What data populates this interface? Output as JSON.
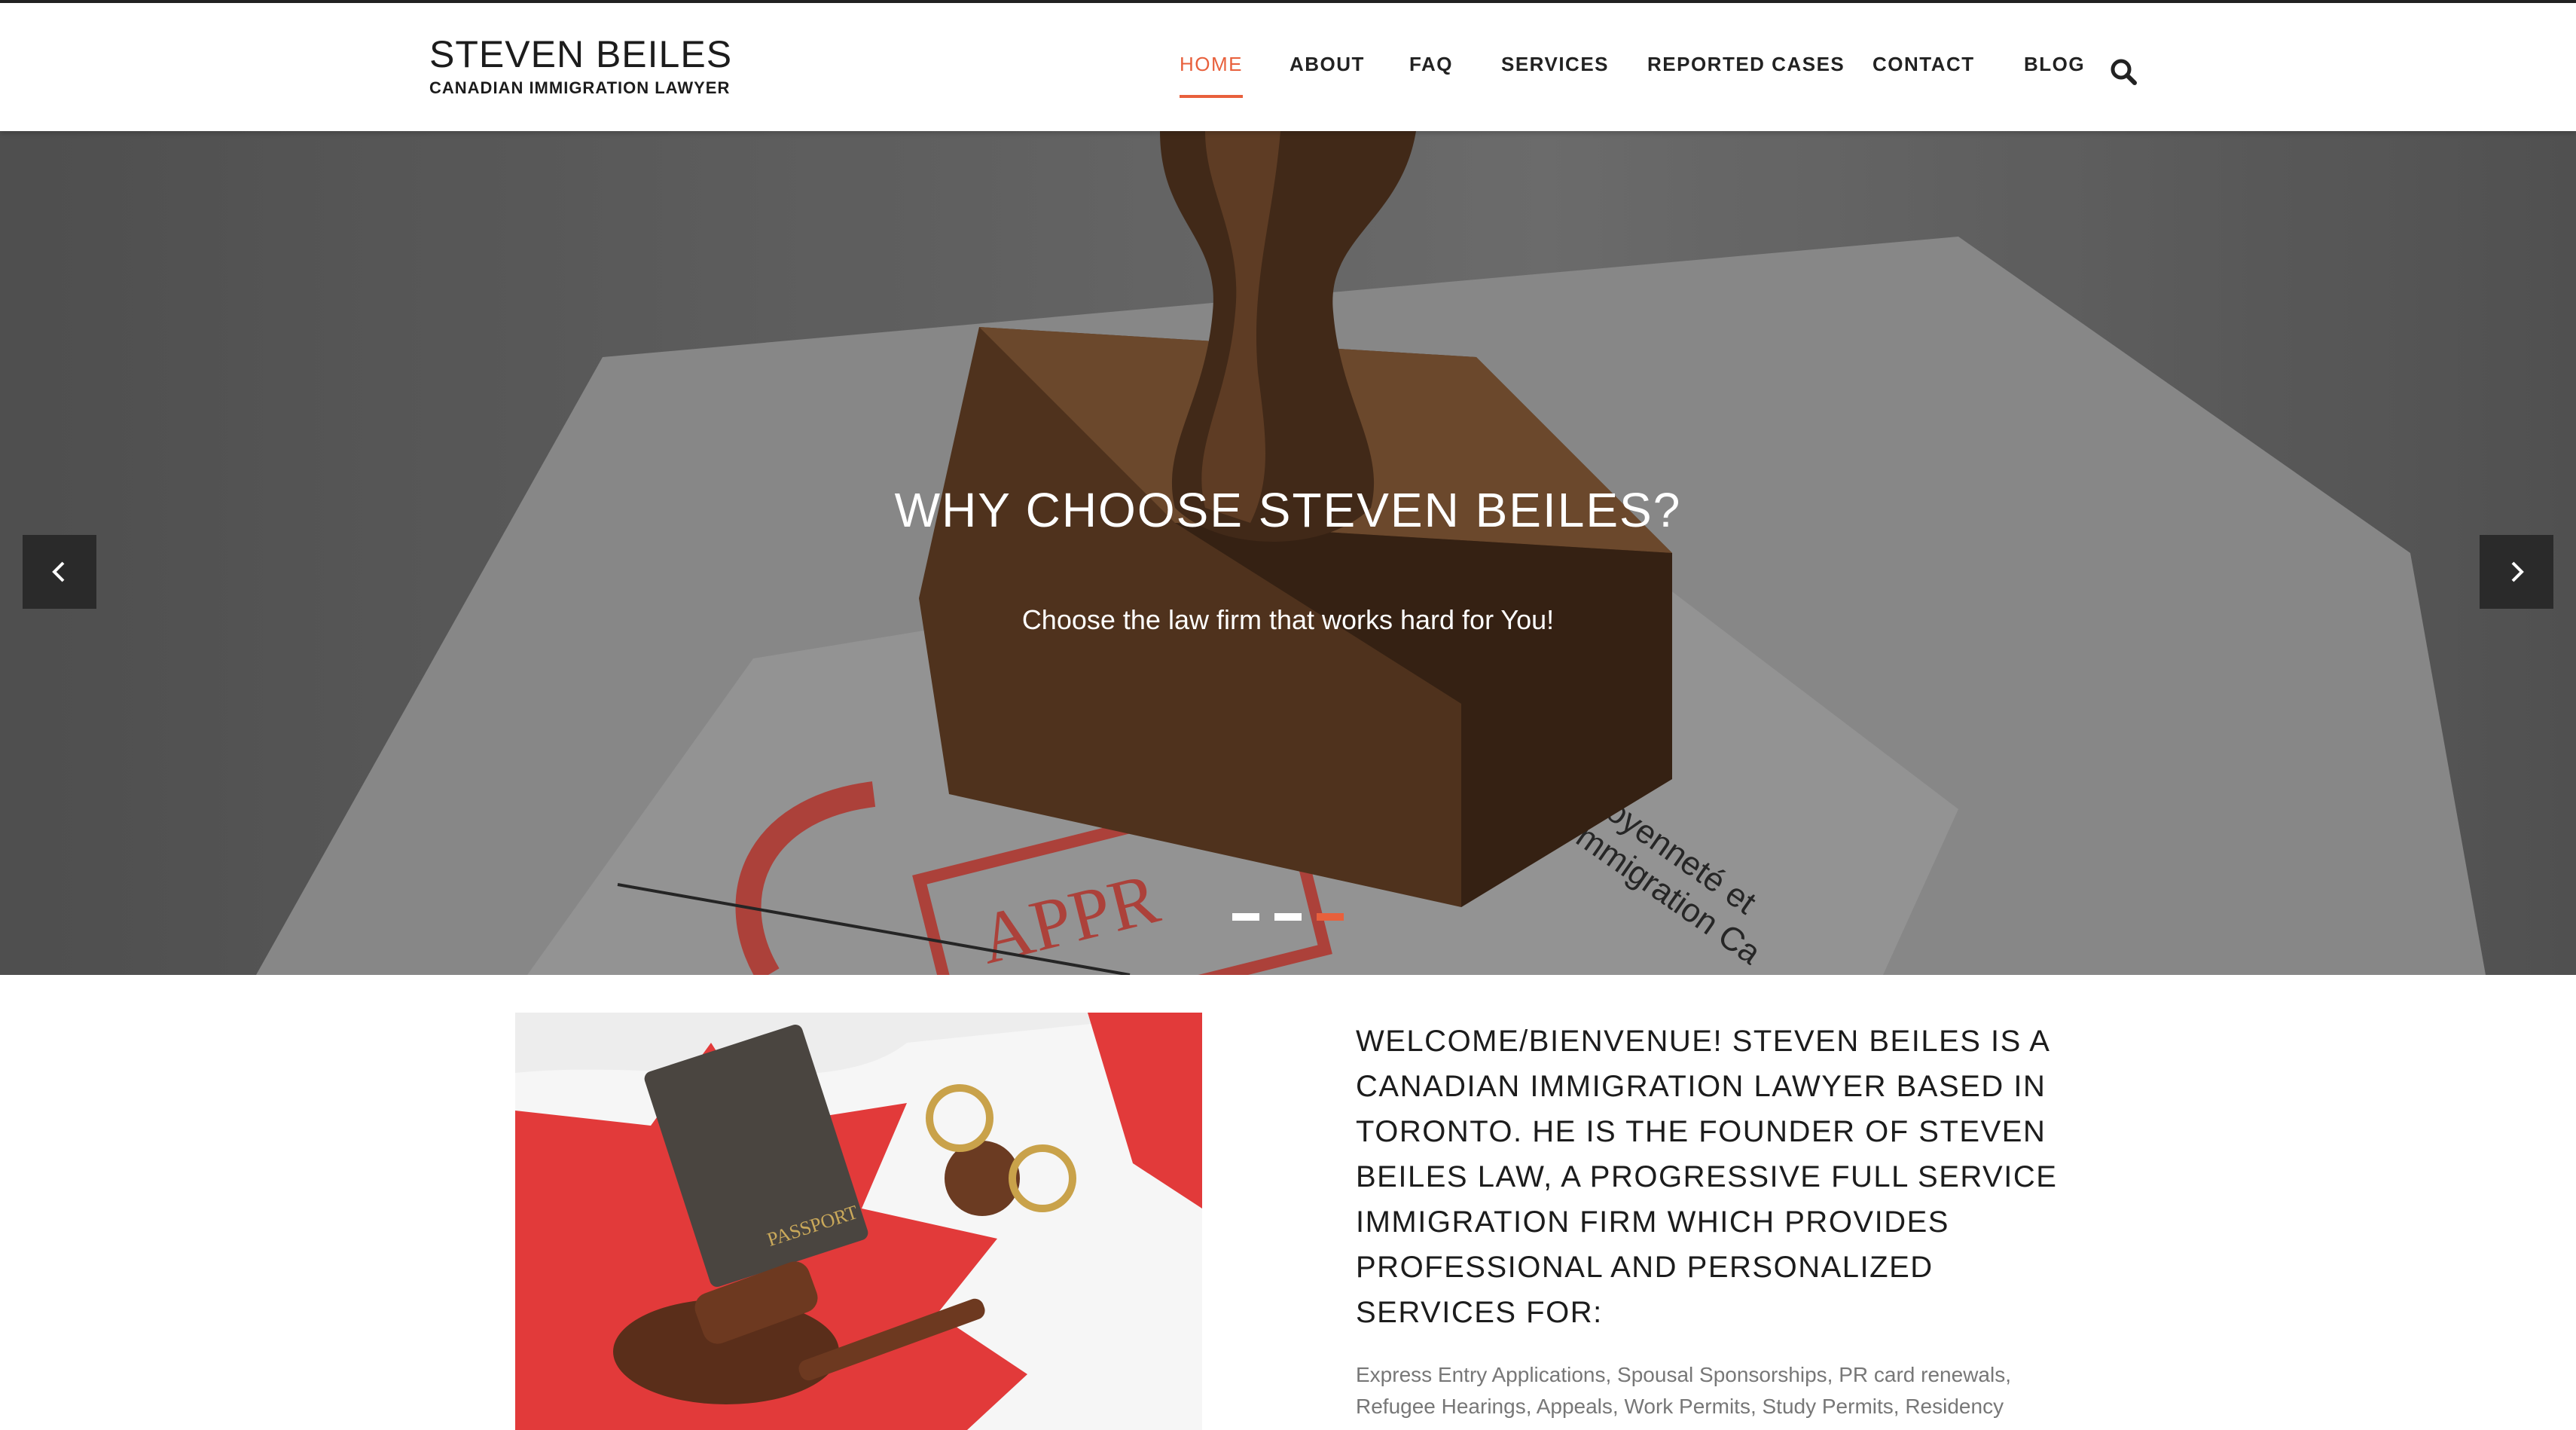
{
  "brand": {
    "title": "STEVEN BEILES",
    "subtitle": "CANADIAN IMMIGRATION LAWYER"
  },
  "nav": {
    "items": [
      {
        "label": "HOME",
        "active": true
      },
      {
        "label": "ABOUT",
        "active": false
      },
      {
        "label": "FAQ",
        "active": false
      },
      {
        "label": "SERVICES",
        "active": false
      },
      {
        "label": "REPORTED CASES",
        "active": false
      },
      {
        "label": "CONTACT",
        "active": false
      },
      {
        "label": "BLOG",
        "active": false
      }
    ],
    "search_icon": "search-icon"
  },
  "hero": {
    "title": "WHY CHOOSE STEVEN BEILES?",
    "subtitle": "Choose the law firm that works hard for You!",
    "slide_count": 3,
    "active_slide": 3,
    "prev_icon": "chevron-left-icon",
    "next_icon": "chevron-right-icon"
  },
  "intro": {
    "heading": "WELCOME/BIENVENUE! STEVEN BEILES IS A CANADIAN IMMIGRATION LAWYER BASED IN TORONTO. HE IS THE FOUNDER OF STEVEN BEILES LAW, A PROGRESSIVE FULL SERVICE IMMIGRATION FIRM WHICH PROVIDES PROFESSIONAL AND PERSONALIZED SERVICES FOR:",
    "services": "Express Entry Applications, Spousal Sponsorships, PR card renewals, Refugee Hearings, Appeals, Work Permits, Study Permits, Residency"
  },
  "colors": {
    "accent": "#e8603c",
    "text": "#1c1c1c",
    "muted": "#777777"
  }
}
